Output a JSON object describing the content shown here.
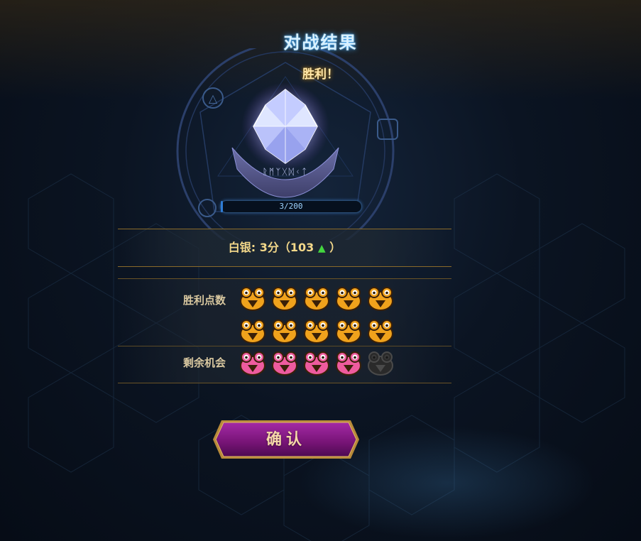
{
  "dialog": {
    "title": "对战结果",
    "result": "胜利！"
  },
  "progress": {
    "current": 3,
    "max": 200,
    "text": "3/200"
  },
  "rank": {
    "prefix": "白银: 3分（103",
    "suffix": "）",
    "arrow_icon": "up-arrow-icon",
    "arrow_color": "#43d63f"
  },
  "victory_points": {
    "label": "胜利点数",
    "filled": 10,
    "total": 10,
    "token_icon": "frog-orange-icon",
    "color": "#f0a21c"
  },
  "remaining_chances": {
    "label": "剩余机会",
    "filled": 4,
    "total": 5,
    "token_icon": "frog-pink-icon",
    "empty_icon": "frog-dark-icon",
    "color": "#ee5b9e",
    "empty_color": "#2a2a2a"
  },
  "confirm_button": {
    "label": "确认"
  },
  "colors": {
    "accent_gold": "#f3d88a",
    "title_glow": "#3fa9ff",
    "button_purple": "#7a1579"
  }
}
